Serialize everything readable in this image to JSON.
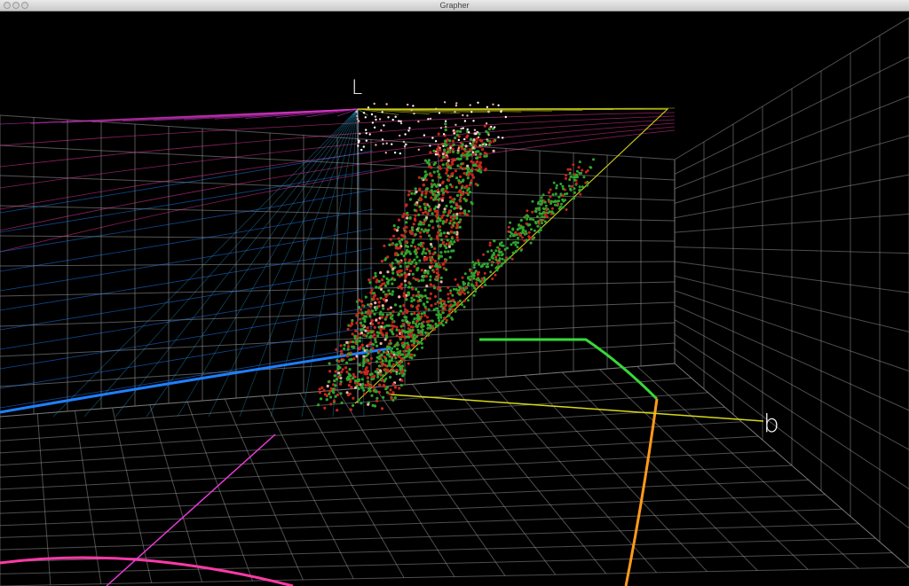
{
  "window": {
    "title": "Grapher",
    "controls": {
      "close": "close-button",
      "minimize": "minimize-button",
      "zoom": "zoom-button"
    }
  },
  "plot": {
    "axis_labels": {
      "vertical": "L",
      "horizontal": "b"
    },
    "colors": {
      "background": "#000000",
      "grid": "#9a9a9a",
      "point_red": "#c8261c",
      "point_green": "#2ea52e",
      "point_light": "#e8b4a8",
      "curve_blue": "#1f7fff",
      "curve_magenta": "#e83ad8",
      "curve_yellow": "#d8d81c",
      "curve_green": "#38d838",
      "curve_orange": "#ff9a1c",
      "curve_pink": "#ff3aa8"
    }
  }
}
